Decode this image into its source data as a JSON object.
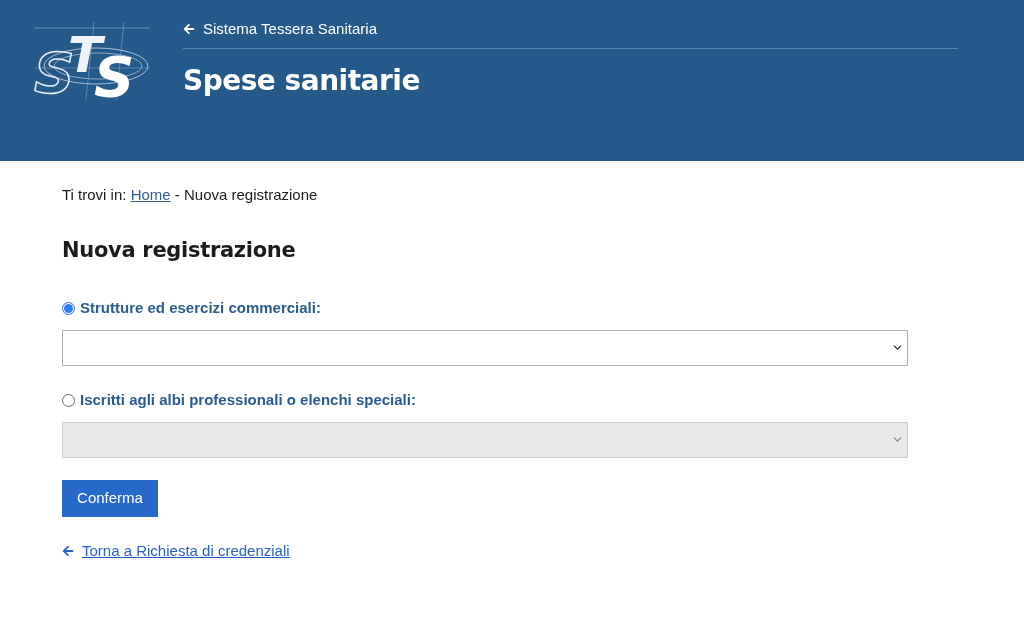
{
  "header": {
    "logo": {
      "text": "STS"
    },
    "back_link": {
      "label": "Sistema Tessera Sanitaria"
    },
    "title": "Spese sanitarie"
  },
  "breadcrumb": {
    "prefix": "Ti trovi in:",
    "separator": "-",
    "items": [
      {
        "label": "Home",
        "kind": "link"
      },
      {
        "label": "Nuova registrazione",
        "kind": "current"
      }
    ]
  },
  "page_title": "Nuova registrazione",
  "options": [
    {
      "label": "Strutture ed esercizi commerciali:",
      "selected": true,
      "select": {
        "disabled": false
      }
    },
    {
      "label": "Iscritti agli albi professionali o elenchi speciali:",
      "selected": false,
      "select": {
        "disabled": true
      }
    }
  ],
  "submit_button": {
    "label": "Conferma"
  },
  "back_link": {
    "label": "Torna a Richiesta di credenziali"
  }
}
